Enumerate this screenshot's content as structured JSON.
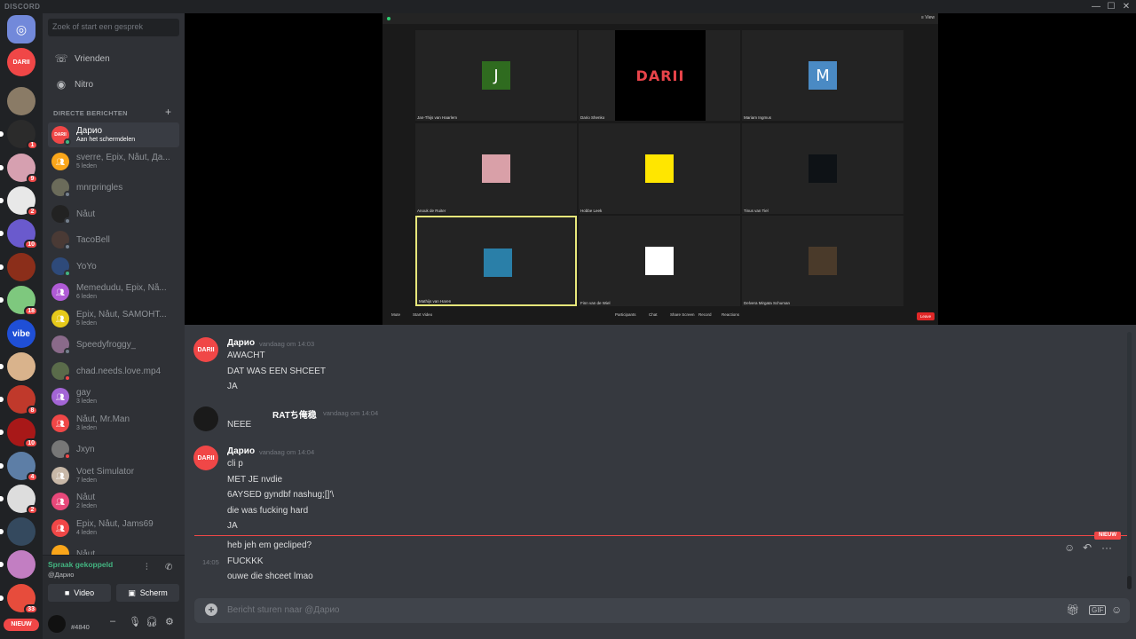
{
  "titlebar": {
    "brand": "DISCORD",
    "min": "—",
    "max": "☐",
    "close": "✕"
  },
  "rail": {
    "servers": [
      {
        "name": "home",
        "label": "",
        "badge": "",
        "color": "#7289da"
      },
      {
        "name": "darii",
        "label": "DARII",
        "badge": "",
        "color": "#f04747"
      },
      {
        "name": "server-3",
        "label": "",
        "badge": "",
        "color": "#8a7b66"
      },
      {
        "name": "server-4",
        "label": "",
        "badge": "1",
        "color": "#2b2b2b"
      },
      {
        "name": "server-5",
        "label": "",
        "badge": "9",
        "color": "#d6a0b0"
      },
      {
        "name": "server-6",
        "label": "",
        "badge": "2",
        "color": "#e8e8e8"
      },
      {
        "name": "server-7",
        "label": "",
        "badge": "10",
        "color": "#6a5acd"
      },
      {
        "name": "server-8",
        "label": "",
        "badge": "",
        "color": "#8b2e1a"
      },
      {
        "name": "server-9",
        "label": "",
        "badge": "18",
        "color": "#7ec87e"
      },
      {
        "name": "vibe",
        "label": "vibe",
        "badge": "",
        "color": "#ffffff"
      },
      {
        "name": "server-11",
        "label": "",
        "badge": "",
        "color": "#d9b38c"
      },
      {
        "name": "server-12",
        "label": "",
        "badge": "8",
        "color": "#c0392b"
      },
      {
        "name": "server-13",
        "label": "",
        "badge": "10",
        "color": "#a81818"
      },
      {
        "name": "server-14",
        "label": "",
        "badge": "4",
        "color": "#5d7ea6"
      },
      {
        "name": "server-15",
        "label": "",
        "badge": "2",
        "color": "#ddd"
      },
      {
        "name": "server-16",
        "label": "",
        "badge": "",
        "color": "#34495e"
      },
      {
        "name": "server-17",
        "label": "",
        "badge": "",
        "color": "#c27ec2"
      },
      {
        "name": "server-18",
        "label": "",
        "badge": "33",
        "color": "#e74c3c"
      }
    ],
    "new_pill": "NIEUW"
  },
  "sidebar": {
    "search_placeholder": "Zoek of start een gesprek",
    "nav": [
      {
        "icon": "friends-icon",
        "glyph": "☏",
        "label": "Vrienden"
      },
      {
        "icon": "nitro-icon",
        "glyph": "◉",
        "label": "Nitro"
      }
    ],
    "dm_header": "DIRECTE BERICHTEN",
    "dm_add": "+",
    "dms": [
      {
        "name": "Дарио",
        "sub": "Aan het schermdelen",
        "color": "#f04747",
        "status": "on",
        "active": true,
        "init": "DARII"
      },
      {
        "name": "sverre, Epix, Nåut, Да...",
        "sub": "5 leden",
        "color": "#faa61a",
        "status": "",
        "active": false,
        "init": ""
      },
      {
        "name": "mnrpringles",
        "sub": "",
        "color": "#6b6b5a",
        "status": "off",
        "active": false,
        "init": ""
      },
      {
        "name": "Nåut",
        "sub": "",
        "color": "#222",
        "status": "off",
        "active": false,
        "init": ""
      },
      {
        "name": "TacoBell",
        "sub": "",
        "color": "#4a3a35",
        "status": "off",
        "active": false,
        "init": ""
      },
      {
        "name": "YoYo",
        "sub": "",
        "color": "#2e4a7a",
        "status": "on",
        "active": false,
        "init": ""
      },
      {
        "name": "Memedudu, Epix, Nå...",
        "sub": "6 leden",
        "color": "#b05bd6",
        "status": "",
        "active": false,
        "init": ""
      },
      {
        "name": "Epix, Nåut, SAMOHT...",
        "sub": "5 leden",
        "color": "#e6c91a",
        "status": "",
        "active": false,
        "init": ""
      },
      {
        "name": "Speedyfroggy_",
        "sub": "",
        "color": "#8a6a8a",
        "status": "off",
        "active": false,
        "init": ""
      },
      {
        "name": "chad.needs.love.mp4",
        "sub": "",
        "color": "#5a6b4a",
        "status": "dnd",
        "active": false,
        "init": ""
      },
      {
        "name": "gay",
        "sub": "3 leden",
        "color": "#a365d6",
        "status": "",
        "active": false,
        "init": ""
      },
      {
        "name": "Nåut, Mr.Man",
        "sub": "3 leden",
        "color": "#f04747",
        "status": "",
        "active": false,
        "init": ""
      },
      {
        "name": "Jxyn",
        "sub": "",
        "color": "#777",
        "status": "dnd",
        "active": false,
        "init": ""
      },
      {
        "name": "Voet Simulator",
        "sub": "7 leden",
        "color": "#c8b8a8",
        "status": "",
        "active": false,
        "init": ""
      },
      {
        "name": "Nåut",
        "sub": "2 leden",
        "color": "#e8487a",
        "status": "",
        "active": false,
        "init": ""
      },
      {
        "name": "Epix, Nåut, Jams69",
        "sub": "4 leden",
        "color": "#f04747",
        "status": "",
        "active": false,
        "init": ""
      },
      {
        "name": "Nåut",
        "sub": "",
        "color": "#faa61a",
        "status": "",
        "active": false,
        "init": ""
      }
    ],
    "voice": {
      "status": "Spraak gekoppeld",
      "sub": "@Дарио",
      "video_label": "Video",
      "screen_label": "Scherm"
    },
    "user": {
      "tag": "#4840"
    }
  },
  "stream": {
    "view_label": "≡ View",
    "tiles": [
      {
        "name": "Jan-Thijs van Haarlem",
        "kind": "letter",
        "glyph": "J",
        "bg": "#2f6b1f"
      },
      {
        "name": "Dario Shenko",
        "kind": "darii",
        "glyph": "DARII",
        "bg": "#000"
      },
      {
        "name": "Mariam Ingmus",
        "kind": "letter",
        "glyph": "M",
        "bg": "#4a8ac4"
      },
      {
        "name": "Anouk de Ruiter",
        "kind": "img",
        "glyph": "",
        "bg": "#d9a0a8"
      },
      {
        "name": "Hobbe Leek",
        "kind": "img",
        "glyph": "",
        "bg": "#ffe600"
      },
      {
        "name": "Tinus van Tiel",
        "kind": "img",
        "glyph": "",
        "bg": "#0e1216"
      },
      {
        "name": "Mathijs van Haren",
        "kind": "img",
        "glyph": "",
        "bg": "#2a7fa8"
      },
      {
        "name": "Finn van de Wiel",
        "kind": "img",
        "glyph": "",
        "bg": "#ffffff"
      },
      {
        "name": "Delvera Mirgata Schuman",
        "kind": "img",
        "glyph": "",
        "bg": "#4a3a2a"
      }
    ],
    "toolbar": [
      "Mute",
      "Start Video",
      "Participants",
      "Chat",
      "Share Screen",
      "Record",
      "Reactions"
    ],
    "leave": "Leave"
  },
  "chat": {
    "groups": [
      {
        "author": "Дарио",
        "time": "vandaag om 14:03",
        "avatar": "DARII",
        "lines": [
          "AWACHT",
          "DAT WAS EEN SHCEET",
          "JA"
        ]
      },
      {
        "author": "RATち俺稳",
        "time": "vandaag om 14:04",
        "avatar": "",
        "lines": [
          "NEEE"
        ]
      },
      {
        "author": "Дарио",
        "time": "vandaag om 14:04",
        "avatar": "DARII",
        "lines": [
          "cli p",
          "MET JE nvdie",
          "6AYSED gyndbf nashug;[]'\\",
          "die was fucking hard",
          "JA"
        ]
      }
    ],
    "new_tag": "NIEUW",
    "after_new": {
      "lines": [
        "heb jeh em gecliped?",
        "FUCKKK",
        "ouwe die shceet lmao"
      ],
      "hover_time": "14:05"
    },
    "composer_placeholder": "Bericht sturen naar @Дарио"
  },
  "colors": {
    "accent": "#7289da",
    "online": "#43b581",
    "danger": "#f04747"
  }
}
